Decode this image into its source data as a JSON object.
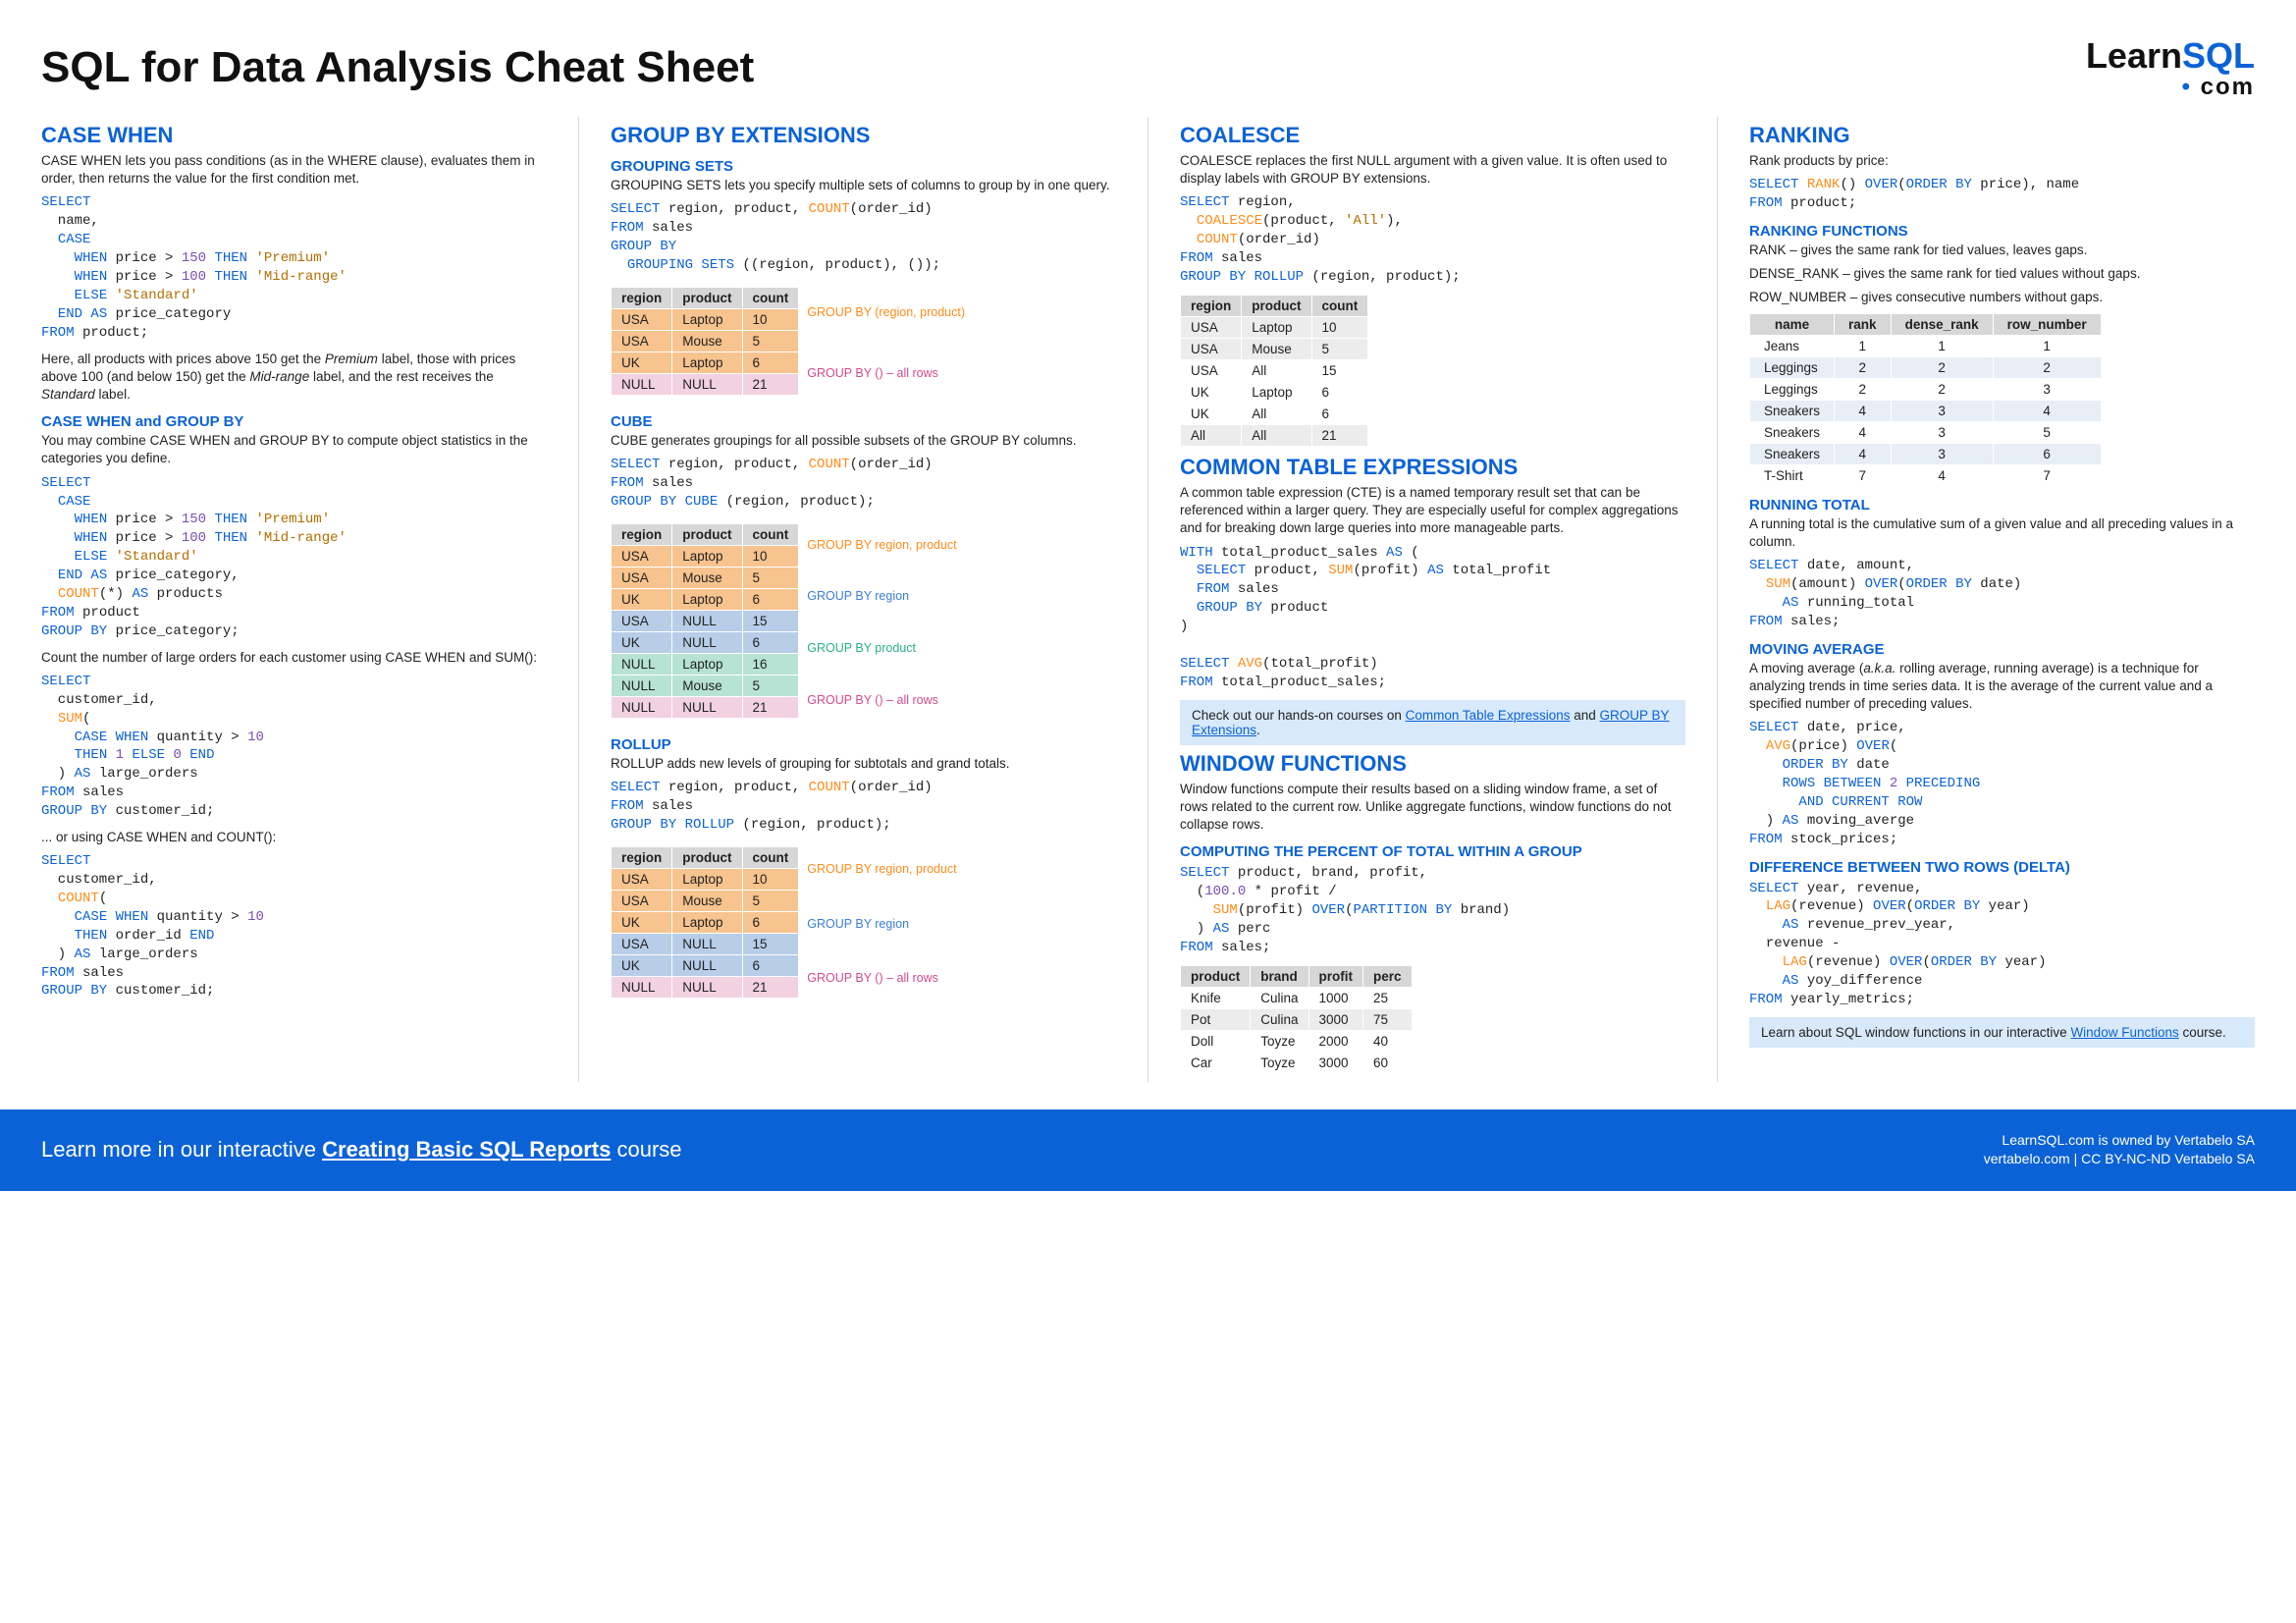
{
  "header": {
    "title": "SQL for Data Analysis Cheat Sheet",
    "logo_learn": "Learn",
    "logo_sql": "SQL",
    "logo_com": "com"
  },
  "c1": {
    "case_when": {
      "title": "CASE WHEN",
      "text1": "CASE  WHEN lets you pass conditions (as in the WHERE clause), evaluates them in order, then returns the value for the first condition met.",
      "text2_a": "Here, all products with prices above 150 get the ",
      "text2_prem": "Premium",
      "text2_b": " label, those with prices above 100 (and below 150) get the ",
      "text2_mid": "Mid-range",
      "text2_c": " label, and the rest receives the ",
      "text2_std": "Standard",
      "text2_d": " label."
    },
    "group": {
      "title": "CASE WHEN and GROUP BY",
      "text1": "You may combine CASE  WHEN and GROUP  BY to compute object statistics in the categories you define.",
      "text2": "Count the number of large orders for each customer using CASE WHEN and SUM():",
      "text3": "... or using CASE  WHEN and COUNT():"
    }
  },
  "c2": {
    "title": "GROUP BY EXTENSIONS",
    "sets": {
      "title": "GROUPING SETS",
      "text": "GROUPING  SETS lets you specify multiple sets of columns to group by in one query.",
      "br1": "GROUP BY (region, product)",
      "br2": "GROUP BY () – all rows"
    },
    "cube": {
      "title": "CUBE",
      "text": "CUBE generates groupings for all possible subsets of the GROUP BY columns.",
      "br1": "GROUP BY region, product",
      "br2": "GROUP BY region",
      "br3": "GROUP BY product",
      "br4": "GROUP BY () – all rows"
    },
    "rollup": {
      "title": "ROLLUP",
      "text": "ROLLUP adds new levels of grouping for subtotals and grand totals.",
      "br1": "GROUP BY region, product",
      "br2": "GROUP BY region",
      "br3": "GROUP BY () – all rows"
    },
    "tbl_h": {
      "c1": "region",
      "c2": "product",
      "c3": "count"
    },
    "sets_rows": [
      [
        "USA",
        "Laptop",
        "10"
      ],
      [
        "USA",
        "Mouse",
        "5"
      ],
      [
        "UK",
        "Laptop",
        "6"
      ],
      [
        "NULL",
        "NULL",
        "21"
      ]
    ],
    "cube_rows": [
      [
        "USA",
        "Laptop",
        "10"
      ],
      [
        "USA",
        "Mouse",
        "5"
      ],
      [
        "UK",
        "Laptop",
        "6"
      ],
      [
        "USA",
        "NULL",
        "15"
      ],
      [
        "UK",
        "NULL",
        "6"
      ],
      [
        "NULL",
        "Laptop",
        "16"
      ],
      [
        "NULL",
        "Mouse",
        "5"
      ],
      [
        "NULL",
        "NULL",
        "21"
      ]
    ],
    "rollup_rows": [
      [
        "USA",
        "Laptop",
        "10"
      ],
      [
        "USA",
        "Mouse",
        "5"
      ],
      [
        "UK",
        "Laptop",
        "6"
      ],
      [
        "USA",
        "NULL",
        "15"
      ],
      [
        "UK",
        "NULL",
        "6"
      ],
      [
        "NULL",
        "NULL",
        "21"
      ]
    ]
  },
  "c3": {
    "coalesce": {
      "title": "COALESCE",
      "text": "COALESCE replaces the first NULL argument with a given value. It is often used to display labels with GROUP  BY extensions.",
      "rows": [
        [
          "USA",
          "Laptop",
          "10"
        ],
        [
          "USA",
          "Mouse",
          "5"
        ],
        [
          "USA",
          "All",
          "15"
        ],
        [
          "UK",
          "Laptop",
          "6"
        ],
        [
          "UK",
          "All",
          "6"
        ],
        [
          "All",
          "All",
          "21"
        ]
      ]
    },
    "cte": {
      "title": "COMMON TABLE EXPRESSIONS",
      "text": "A common table expression (CTE) is a named temporary result set that can be referenced within a larger query. They are especially useful for complex aggregations and for breaking down large queries into more manageable parts.",
      "callout_a": "Check out our hands-on courses on ",
      "callout_l1": "Common Table Expressions",
      "callout_b": " and ",
      "callout_l2": "GROUP BY Extensions",
      "callout_c": "."
    },
    "wf": {
      "title": "WINDOW FUNCTIONS",
      "text": "Window functions compute their results based on a sliding window frame, a set of rows related to the current row. Unlike aggregate functions, window functions do not collapse rows.",
      "sub": "COMPUTING THE PERCENT OF TOTAL WITHIN A GROUP",
      "th": {
        "c1": "product",
        "c2": "brand",
        "c3": "profit",
        "c4": "perc"
      },
      "rows": [
        [
          "Knife",
          "Culina",
          "1000",
          "25"
        ],
        [
          "Pot",
          "Culina",
          "3000",
          "75"
        ],
        [
          "Doll",
          "Toyze",
          "2000",
          "40"
        ],
        [
          "Car",
          "Toyze",
          "3000",
          "60"
        ]
      ]
    }
  },
  "c4": {
    "ranking": {
      "title": "RANKING",
      "text": "Rank products by price:",
      "sub": "RANKING FUNCTIONS",
      "r1": "RANK – gives the same rank for tied values, leaves gaps.",
      "r2": "DENSE_RANK – gives the same rank for tied values without gaps.",
      "r3": "ROW_NUMBER – gives consecutive numbers without gaps.",
      "th": {
        "c1": "name",
        "c2": "rank",
        "c3": "dense_rank",
        "c4": "row_number"
      },
      "rows": [
        [
          "Jeans",
          "1",
          "1",
          "1"
        ],
        [
          "Leggings",
          "2",
          "2",
          "2"
        ],
        [
          "Leggings",
          "2",
          "2",
          "3"
        ],
        [
          "Sneakers",
          "4",
          "3",
          "4"
        ],
        [
          "Sneakers",
          "4",
          "3",
          "5"
        ],
        [
          "Sneakers",
          "4",
          "3",
          "6"
        ],
        [
          "T-Shirt",
          "7",
          "4",
          "7"
        ]
      ]
    },
    "running": {
      "title": "RUNNING TOTAL",
      "text": "A running total is the cumulative sum of a given value and all preceding values in a column."
    },
    "moving": {
      "title": "MOVING AVERAGE",
      "text_a": "A moving average (",
      "text_aka": "a.k.a.",
      "text_b": " rolling average, running average) is a technique for analyzing trends in time series data. It is the average of the current value and a specified number of preceding values."
    },
    "delta": {
      "title": "DIFFERENCE BETWEEN TWO ROWS (DELTA)"
    },
    "callout": {
      "a": "Learn about SQL window functions in our interactive ",
      "l": "Window Functions",
      "b": " course."
    }
  },
  "footer": {
    "left_a": "Learn more in our interactive ",
    "left_link": "Creating Basic SQL Reports",
    "left_b": " course",
    "r1": "LearnSQL.com is owned by Vertabelo SA",
    "r2": "vertabelo.com | CC BY-NC-ND Vertabelo SA"
  }
}
